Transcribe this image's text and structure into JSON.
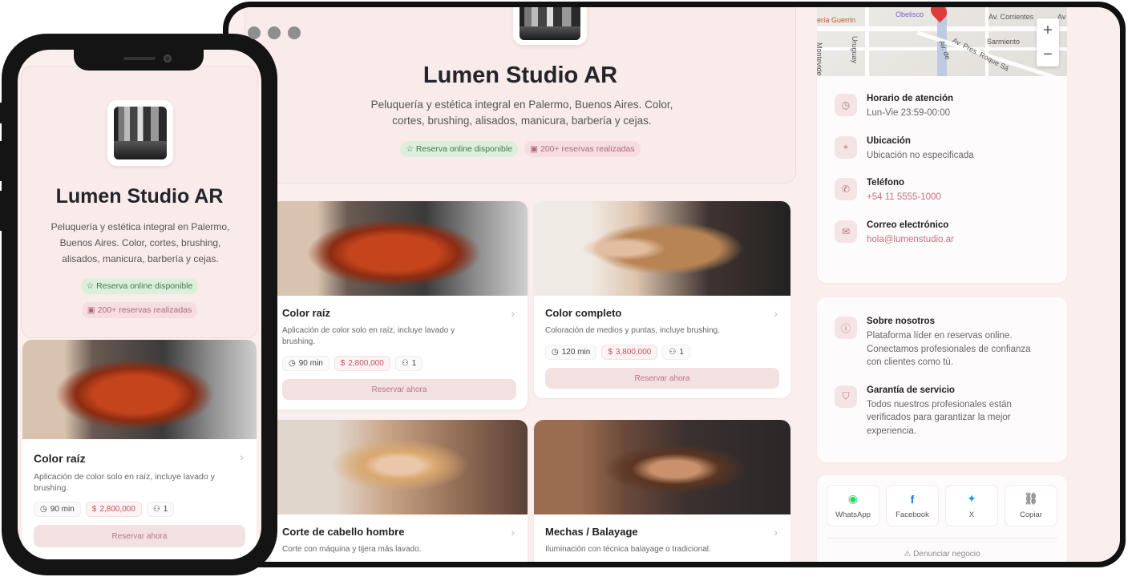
{
  "business": {
    "name": "Lumen Studio AR",
    "description": "Peluquería y estética integral en Palermo, Buenos Aires. Color, cortes, brushing, alisados, manicura, barbería y cejas.",
    "badges": [
      {
        "label": "Reserva online disponible",
        "icon": "star-icon"
      },
      {
        "label": "200+ reservas realizadas",
        "icon": "calendar-icon"
      }
    ]
  },
  "services": [
    {
      "title": "Color raíz",
      "desc": "Aplicación de color solo en raíz, incluye lavado y brushing.",
      "duration": "90 min",
      "price": "2,800,000",
      "capacity": "1",
      "cta": "Reservar ahora"
    },
    {
      "title": "Color completo",
      "desc": "Coloración de medios y puntas, incluye brushing.",
      "duration": "120 min",
      "price": "3,800,000",
      "capacity": "1",
      "cta": "Reservar ahora"
    },
    {
      "title": "Corte de cabello hombre",
      "desc": "Corte con máquina y tijera más lavado.",
      "duration": "",
      "price": "",
      "capacity": "",
      "cta": ""
    },
    {
      "title": "Mechas / Balayage",
      "desc": "Iluminación con técnica balayage o tradicional.",
      "duration": "",
      "price": "",
      "capacity": "",
      "cta": ""
    }
  ],
  "map": {
    "labels": [
      "ería Guerrin",
      "Obelisco",
      "Av. Corrientes",
      "Av",
      "Sarmiento",
      "Uruguay",
      "Montevideo",
      "Av. de",
      "Av. Pres. Roque Sá"
    ],
    "zoom_in": "+",
    "zoom_out": "−"
  },
  "contact": [
    {
      "title": "Horario de atención",
      "value": "Lun-Vie 23:59-00:00",
      "icon": "clock-icon",
      "link": false
    },
    {
      "title": "Ubicación",
      "value": "Ubicación no especificada",
      "icon": "location-pin-icon",
      "link": false
    },
    {
      "title": "Teléfono",
      "value": "+54 11 5555-1000",
      "icon": "phone-icon",
      "link": true
    },
    {
      "title": "Correo electrónico",
      "value": "hola@lumenstudio.ar",
      "icon": "mail-icon",
      "link": true
    }
  ],
  "about": [
    {
      "title": "Sobre nosotros",
      "value": "Plataforma líder en reservas online. Conectamos profesionales de confianza con clientes como tú.",
      "icon": "info-icon"
    },
    {
      "title": "Garantía de servicio",
      "value": "Todos nuestros profesionales están verificados para garantizar la mejor experiencia.",
      "icon": "shield-icon"
    }
  ],
  "share": [
    {
      "label": "WhatsApp",
      "icon": "whatsapp-icon",
      "color": "#25d366"
    },
    {
      "label": "Facebook",
      "icon": "facebook-icon",
      "color": "#1877f2"
    },
    {
      "label": "X",
      "icon": "twitter-icon",
      "color": "#1d9bf0"
    },
    {
      "label": "Copiar",
      "icon": "link-icon",
      "color": "#888888"
    }
  ],
  "report_label": "Denunciar negocio",
  "currency_symbol": "$",
  "colors": {
    "accent": "#c0737d",
    "background": "#fbefed"
  }
}
